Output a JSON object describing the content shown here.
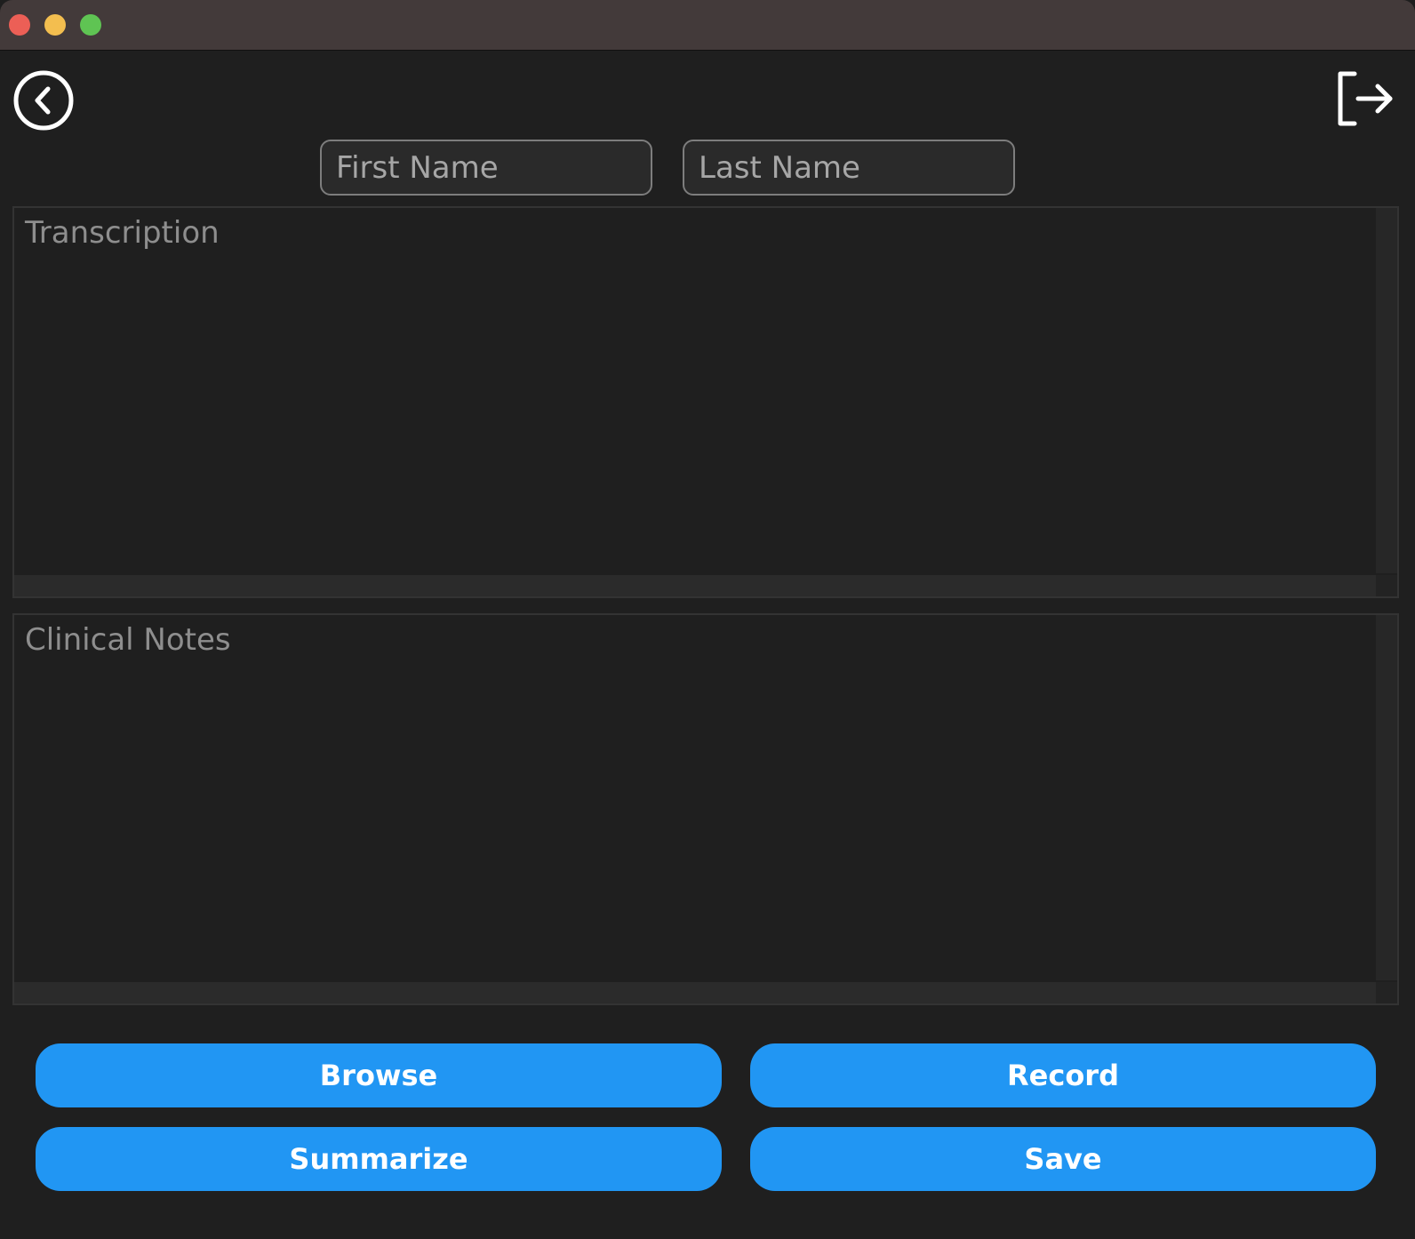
{
  "window": {
    "controls": [
      "close",
      "minimize",
      "maximize"
    ]
  },
  "header": {
    "back_icon": "back-circle-icon",
    "logout_icon": "logout-icon"
  },
  "patient": {
    "first_name": {
      "value": "",
      "placeholder": "First Name"
    },
    "last_name": {
      "value": "",
      "placeholder": "Last Name"
    }
  },
  "transcription": {
    "value": "",
    "placeholder": "Transcription"
  },
  "clinical_notes": {
    "value": "",
    "placeholder": "Clinical Notes"
  },
  "actions": {
    "browse_label": "Browse",
    "record_label": "Record",
    "summarize_label": "Summarize",
    "save_label": "Save"
  },
  "colors": {
    "accent": "#2196f3",
    "background": "#1f1f1f",
    "titlebar": "#433a3a",
    "close": "#ec5f56",
    "minimize": "#f3be4f",
    "maximize": "#5fc453"
  }
}
